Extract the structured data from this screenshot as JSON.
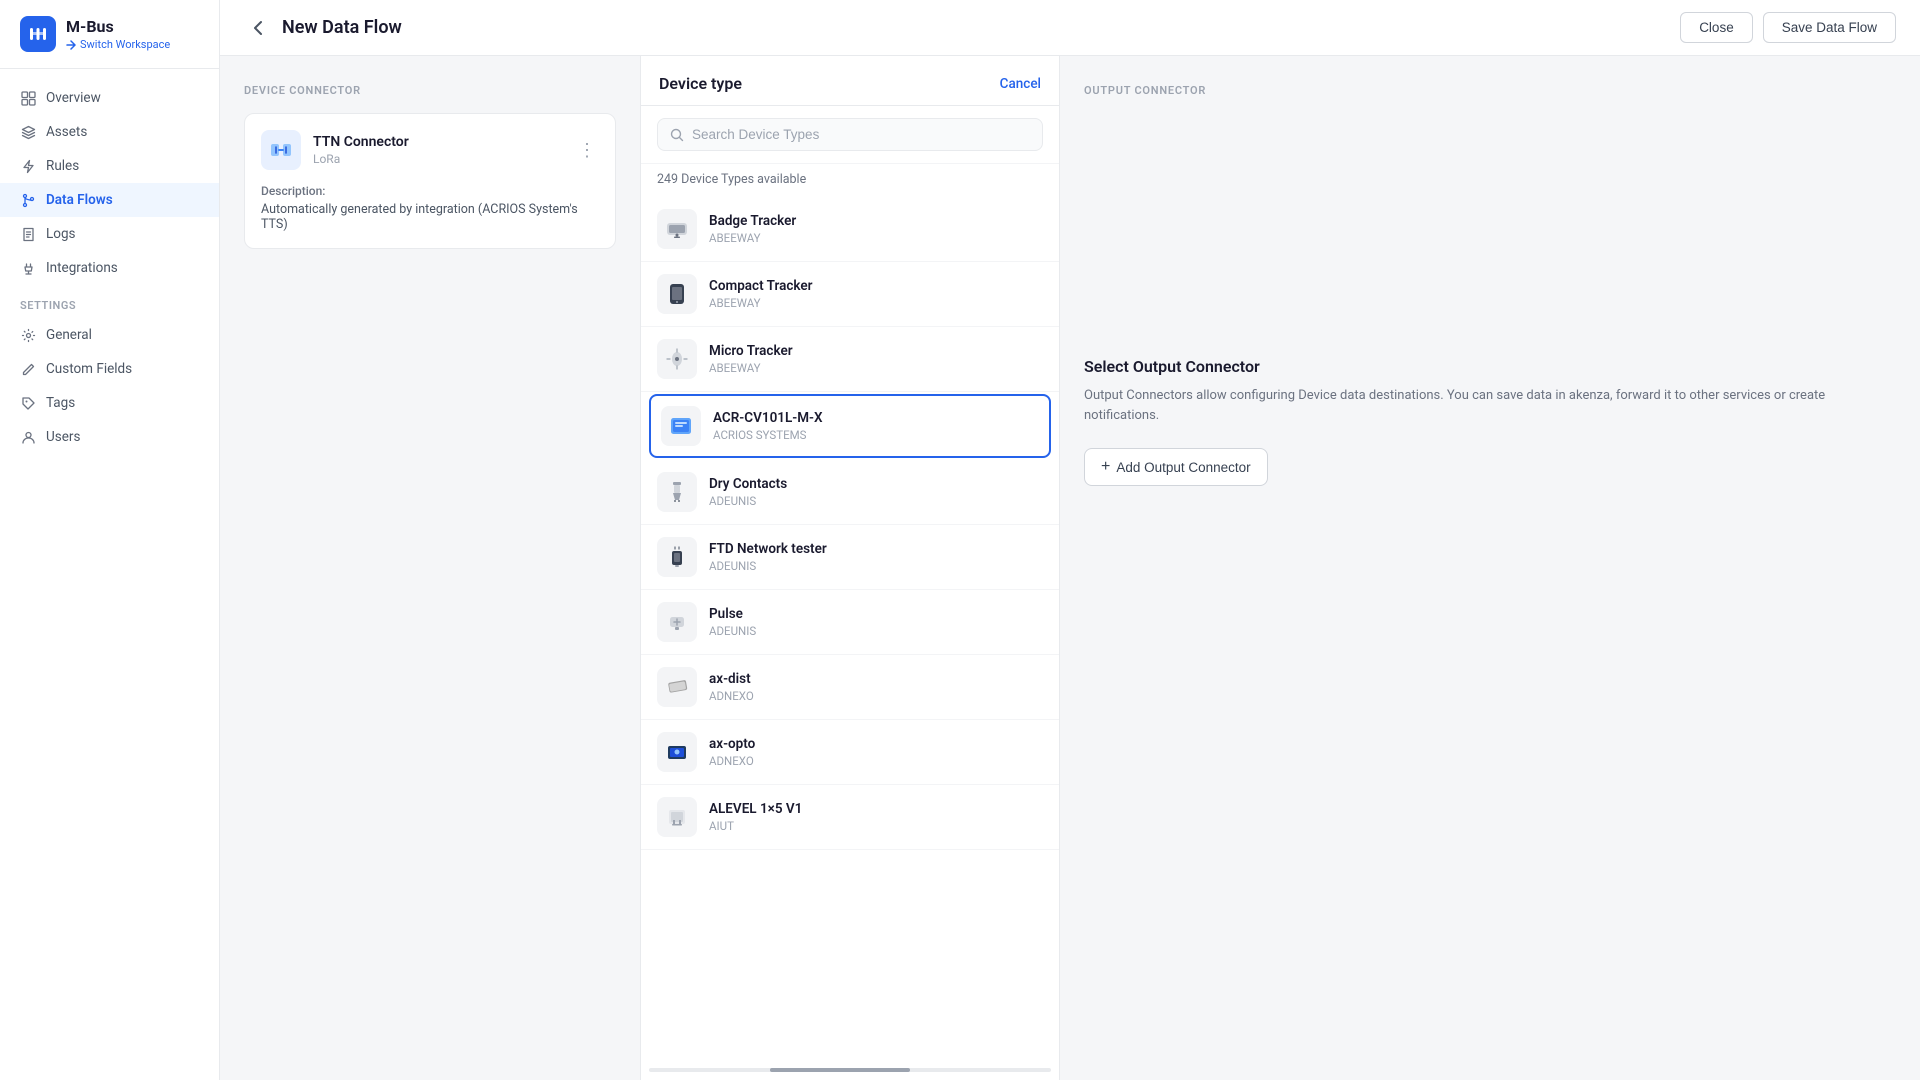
{
  "app": {
    "logo_text": "M",
    "workspace_name": "M-Bus",
    "switch_workspace_label": "Switch Workspace"
  },
  "sidebar": {
    "nav_items": [
      {
        "id": "overview",
        "label": "Overview",
        "icon": "grid"
      },
      {
        "id": "assets",
        "label": "Assets",
        "icon": "layers"
      },
      {
        "id": "rules",
        "label": "Rules",
        "icon": "zap"
      },
      {
        "id": "data-flows",
        "label": "Data Flows",
        "icon": "git-branch",
        "active": true
      },
      {
        "id": "logs",
        "label": "Logs",
        "icon": "file-text"
      },
      {
        "id": "integrations",
        "label": "Integrations",
        "icon": "plug"
      }
    ],
    "settings_label": "SETTINGS",
    "settings_items": [
      {
        "id": "general",
        "label": "General",
        "icon": "settings"
      },
      {
        "id": "custom-fields",
        "label": "Custom Fields",
        "icon": "edit"
      },
      {
        "id": "tags",
        "label": "Tags",
        "icon": "tag"
      },
      {
        "id": "users",
        "label": "Users",
        "icon": "user"
      }
    ]
  },
  "header": {
    "title": "New Data Flow",
    "close_label": "Close",
    "save_label": "Save Data Flow"
  },
  "device_connector": {
    "panel_label": "DEVICE CONNECTOR",
    "card": {
      "name": "TTN Connector",
      "type": "LoRa",
      "description_label": "Description:",
      "description": "Automatically generated by integration (ACRIOS System's TTS)"
    }
  },
  "device_type": {
    "panel_title": "Device type",
    "cancel_label": "Cancel",
    "search_placeholder": "Search Device Types",
    "available_count": "249 Device Types available",
    "devices": [
      {
        "id": 1,
        "name": "Badge Tracker",
        "brand": "ABEEWAY",
        "icon": "📡"
      },
      {
        "id": 2,
        "name": "Compact Tracker",
        "brand": "ABEEWAY",
        "icon": "📱"
      },
      {
        "id": 3,
        "name": "Micro Tracker",
        "brand": "ABEEWAY",
        "icon": "📍"
      },
      {
        "id": 4,
        "name": "ACR-CV101L-M-X",
        "brand": "ACRIOS SYSTEMS",
        "icon": "📦",
        "selected": true
      },
      {
        "id": 5,
        "name": "Dry Contacts",
        "brand": "ADEUNIS",
        "icon": "🔌"
      },
      {
        "id": 6,
        "name": "FTD Network tester",
        "brand": "ADEUNIS",
        "icon": "📶"
      },
      {
        "id": 7,
        "name": "Pulse",
        "brand": "ADEUNIS",
        "icon": "💡"
      },
      {
        "id": 8,
        "name": "ax-dist",
        "brand": "ADNEXO",
        "icon": "⚙️"
      },
      {
        "id": 9,
        "name": "ax-opto",
        "brand": "ADNEXO",
        "icon": "🔷"
      },
      {
        "id": 10,
        "name": "ALEVEL 1×5 V1",
        "brand": "AIUT",
        "icon": "📊"
      }
    ]
  },
  "output_connector": {
    "panel_label": "OUTPUT CONNECTOR",
    "select_title": "Select Output Connector",
    "description": "Output Connectors allow configuring Device data destinations. You can save data in akenza, forward it to other services or create notifications.",
    "add_button_label": "Add Output Connector"
  }
}
